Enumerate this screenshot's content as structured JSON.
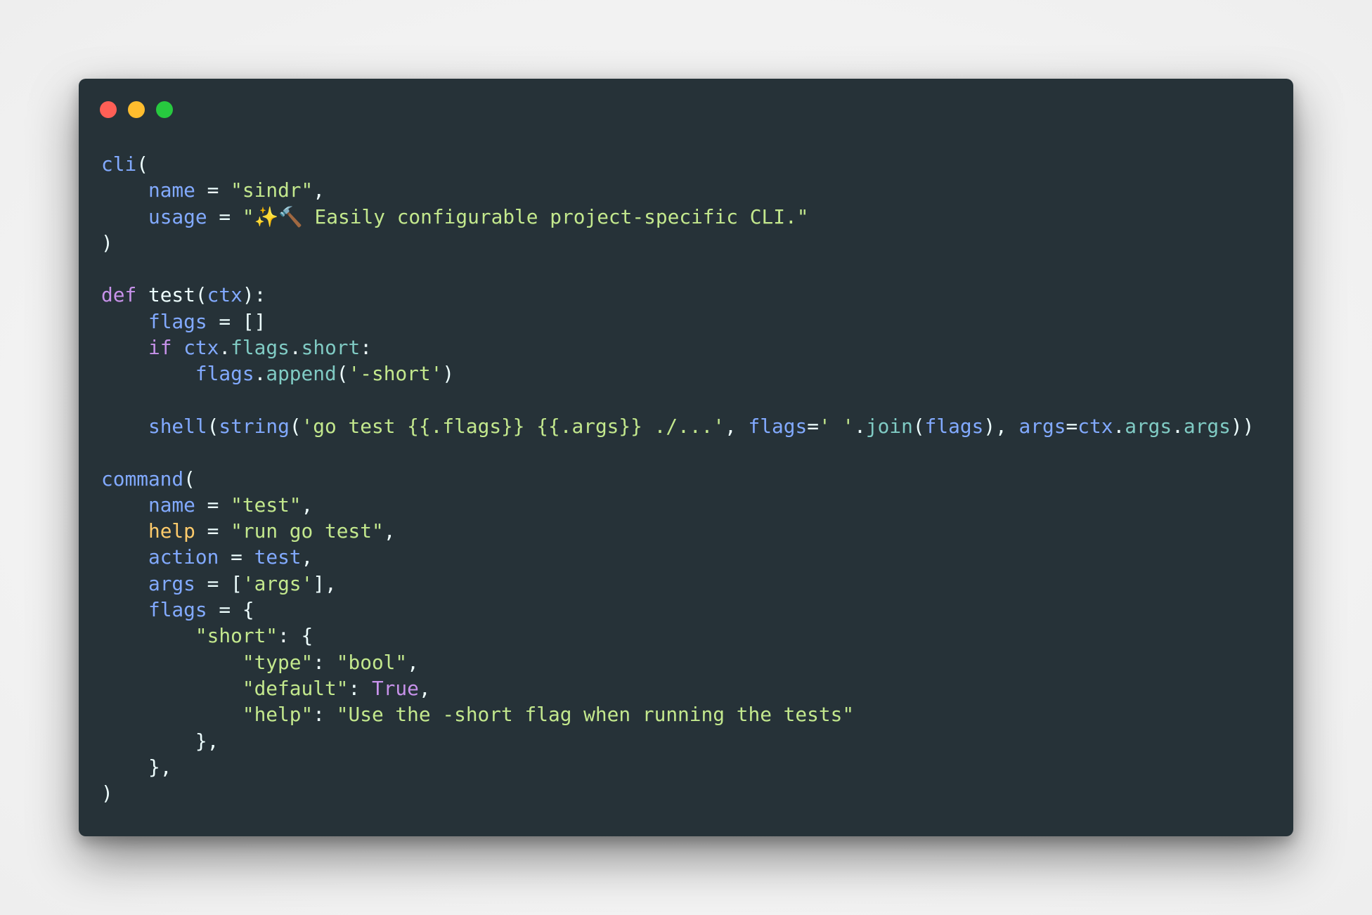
{
  "window": {
    "controls": {
      "close_color": "#ff5f56",
      "minimize_color": "#ffbd2e",
      "maximize_color": "#27c93f"
    }
  },
  "editor": {
    "theme_colors": {
      "background": "#263238",
      "plain": "#eeffff",
      "function": "#82aaff",
      "property": "#80cbc4",
      "string": "#c3e88d",
      "keyword": "#c792ea",
      "highlight": "#ffcb6b"
    },
    "lines": [
      [
        {
          "t": "cli",
          "c": "func"
        },
        {
          "t": "(",
          "c": "punc"
        }
      ],
      [
        {
          "t": "    ",
          "c": "plain"
        },
        {
          "t": "name",
          "c": "var"
        },
        {
          "t": " = ",
          "c": "punc"
        },
        {
          "t": "\"sindr\"",
          "c": "str"
        },
        {
          "t": ",",
          "c": "punc"
        }
      ],
      [
        {
          "t": "    ",
          "c": "plain"
        },
        {
          "t": "usage",
          "c": "var"
        },
        {
          "t": " = ",
          "c": "punc"
        },
        {
          "t": "\"✨🔨 Easily configurable project-specific CLI.\"",
          "c": "str"
        }
      ],
      [
        {
          "t": ")",
          "c": "punc"
        }
      ],
      [],
      [
        {
          "t": "def",
          "c": "kw"
        },
        {
          "t": " test(",
          "c": "plain"
        },
        {
          "t": "ctx",
          "c": "var"
        },
        {
          "t": "):",
          "c": "punc"
        }
      ],
      [
        {
          "t": "    ",
          "c": "plain"
        },
        {
          "t": "flags",
          "c": "var"
        },
        {
          "t": " = []",
          "c": "punc"
        }
      ],
      [
        {
          "t": "    ",
          "c": "plain"
        },
        {
          "t": "if",
          "c": "kw"
        },
        {
          "t": " ",
          "c": "plain"
        },
        {
          "t": "ctx",
          "c": "var"
        },
        {
          "t": ".",
          "c": "punc"
        },
        {
          "t": "flags",
          "c": "prop"
        },
        {
          "t": ".",
          "c": "punc"
        },
        {
          "t": "short",
          "c": "prop"
        },
        {
          "t": ":",
          "c": "punc"
        }
      ],
      [
        {
          "t": "        ",
          "c": "plain"
        },
        {
          "t": "flags",
          "c": "var"
        },
        {
          "t": ".",
          "c": "punc"
        },
        {
          "t": "append",
          "c": "prop"
        },
        {
          "t": "(",
          "c": "punc"
        },
        {
          "t": "'-short'",
          "c": "str"
        },
        {
          "t": ")",
          "c": "punc"
        }
      ],
      [],
      [
        {
          "t": "    ",
          "c": "plain"
        },
        {
          "t": "shell",
          "c": "func"
        },
        {
          "t": "(",
          "c": "punc"
        },
        {
          "t": "string",
          "c": "func"
        },
        {
          "t": "(",
          "c": "punc"
        },
        {
          "t": "'go test {{.flags}} {{.args}} ./...'",
          "c": "str"
        },
        {
          "t": ", ",
          "c": "punc"
        },
        {
          "t": "flags",
          "c": "var"
        },
        {
          "t": "=",
          "c": "punc"
        },
        {
          "t": "' '",
          "c": "str"
        },
        {
          "t": ".",
          "c": "punc"
        },
        {
          "t": "join",
          "c": "prop"
        },
        {
          "t": "(",
          "c": "punc"
        },
        {
          "t": "flags",
          "c": "var"
        },
        {
          "t": "), ",
          "c": "punc"
        },
        {
          "t": "args",
          "c": "var"
        },
        {
          "t": "=",
          "c": "punc"
        },
        {
          "t": "ctx",
          "c": "var"
        },
        {
          "t": ".",
          "c": "punc"
        },
        {
          "t": "args",
          "c": "prop"
        },
        {
          "t": ".",
          "c": "punc"
        },
        {
          "t": "args",
          "c": "prop"
        },
        {
          "t": "))",
          "c": "punc"
        }
      ],
      [],
      [
        {
          "t": "command",
          "c": "func"
        },
        {
          "t": "(",
          "c": "punc"
        }
      ],
      [
        {
          "t": "    ",
          "c": "plain"
        },
        {
          "t": "name",
          "c": "var"
        },
        {
          "t": " = ",
          "c": "punc"
        },
        {
          "t": "\"test\"",
          "c": "str"
        },
        {
          "t": ",",
          "c": "punc"
        }
      ],
      [
        {
          "t": "    ",
          "c": "plain"
        },
        {
          "t": "help",
          "c": "help"
        },
        {
          "t": " = ",
          "c": "punc"
        },
        {
          "t": "\"run go test\"",
          "c": "str"
        },
        {
          "t": ",",
          "c": "punc"
        }
      ],
      [
        {
          "t": "    ",
          "c": "plain"
        },
        {
          "t": "action",
          "c": "var"
        },
        {
          "t": " = ",
          "c": "punc"
        },
        {
          "t": "test",
          "c": "var"
        },
        {
          "t": ",",
          "c": "punc"
        }
      ],
      [
        {
          "t": "    ",
          "c": "plain"
        },
        {
          "t": "args",
          "c": "var"
        },
        {
          "t": " = [",
          "c": "punc"
        },
        {
          "t": "'args'",
          "c": "str"
        },
        {
          "t": "],",
          "c": "punc"
        }
      ],
      [
        {
          "t": "    ",
          "c": "plain"
        },
        {
          "t": "flags",
          "c": "var"
        },
        {
          "t": " = {",
          "c": "punc"
        }
      ],
      [
        {
          "t": "        ",
          "c": "plain"
        },
        {
          "t": "\"short\"",
          "c": "str"
        },
        {
          "t": ": {",
          "c": "punc"
        }
      ],
      [
        {
          "t": "            ",
          "c": "plain"
        },
        {
          "t": "\"type\"",
          "c": "str"
        },
        {
          "t": ": ",
          "c": "punc"
        },
        {
          "t": "\"bool\"",
          "c": "str"
        },
        {
          "t": ",",
          "c": "punc"
        }
      ],
      [
        {
          "t": "            ",
          "c": "plain"
        },
        {
          "t": "\"default\"",
          "c": "str"
        },
        {
          "t": ": ",
          "c": "punc"
        },
        {
          "t": "True",
          "c": "kw"
        },
        {
          "t": ",",
          "c": "punc"
        }
      ],
      [
        {
          "t": "            ",
          "c": "plain"
        },
        {
          "t": "\"help\"",
          "c": "str"
        },
        {
          "t": ": ",
          "c": "punc"
        },
        {
          "t": "\"Use the -short flag when running the tests\"",
          "c": "str"
        }
      ],
      [
        {
          "t": "        ",
          "c": "plain"
        },
        {
          "t": "},",
          "c": "punc"
        }
      ],
      [
        {
          "t": "    ",
          "c": "plain"
        },
        {
          "t": "},",
          "c": "punc"
        }
      ],
      [
        {
          "t": ")",
          "c": "punc"
        }
      ]
    ]
  }
}
